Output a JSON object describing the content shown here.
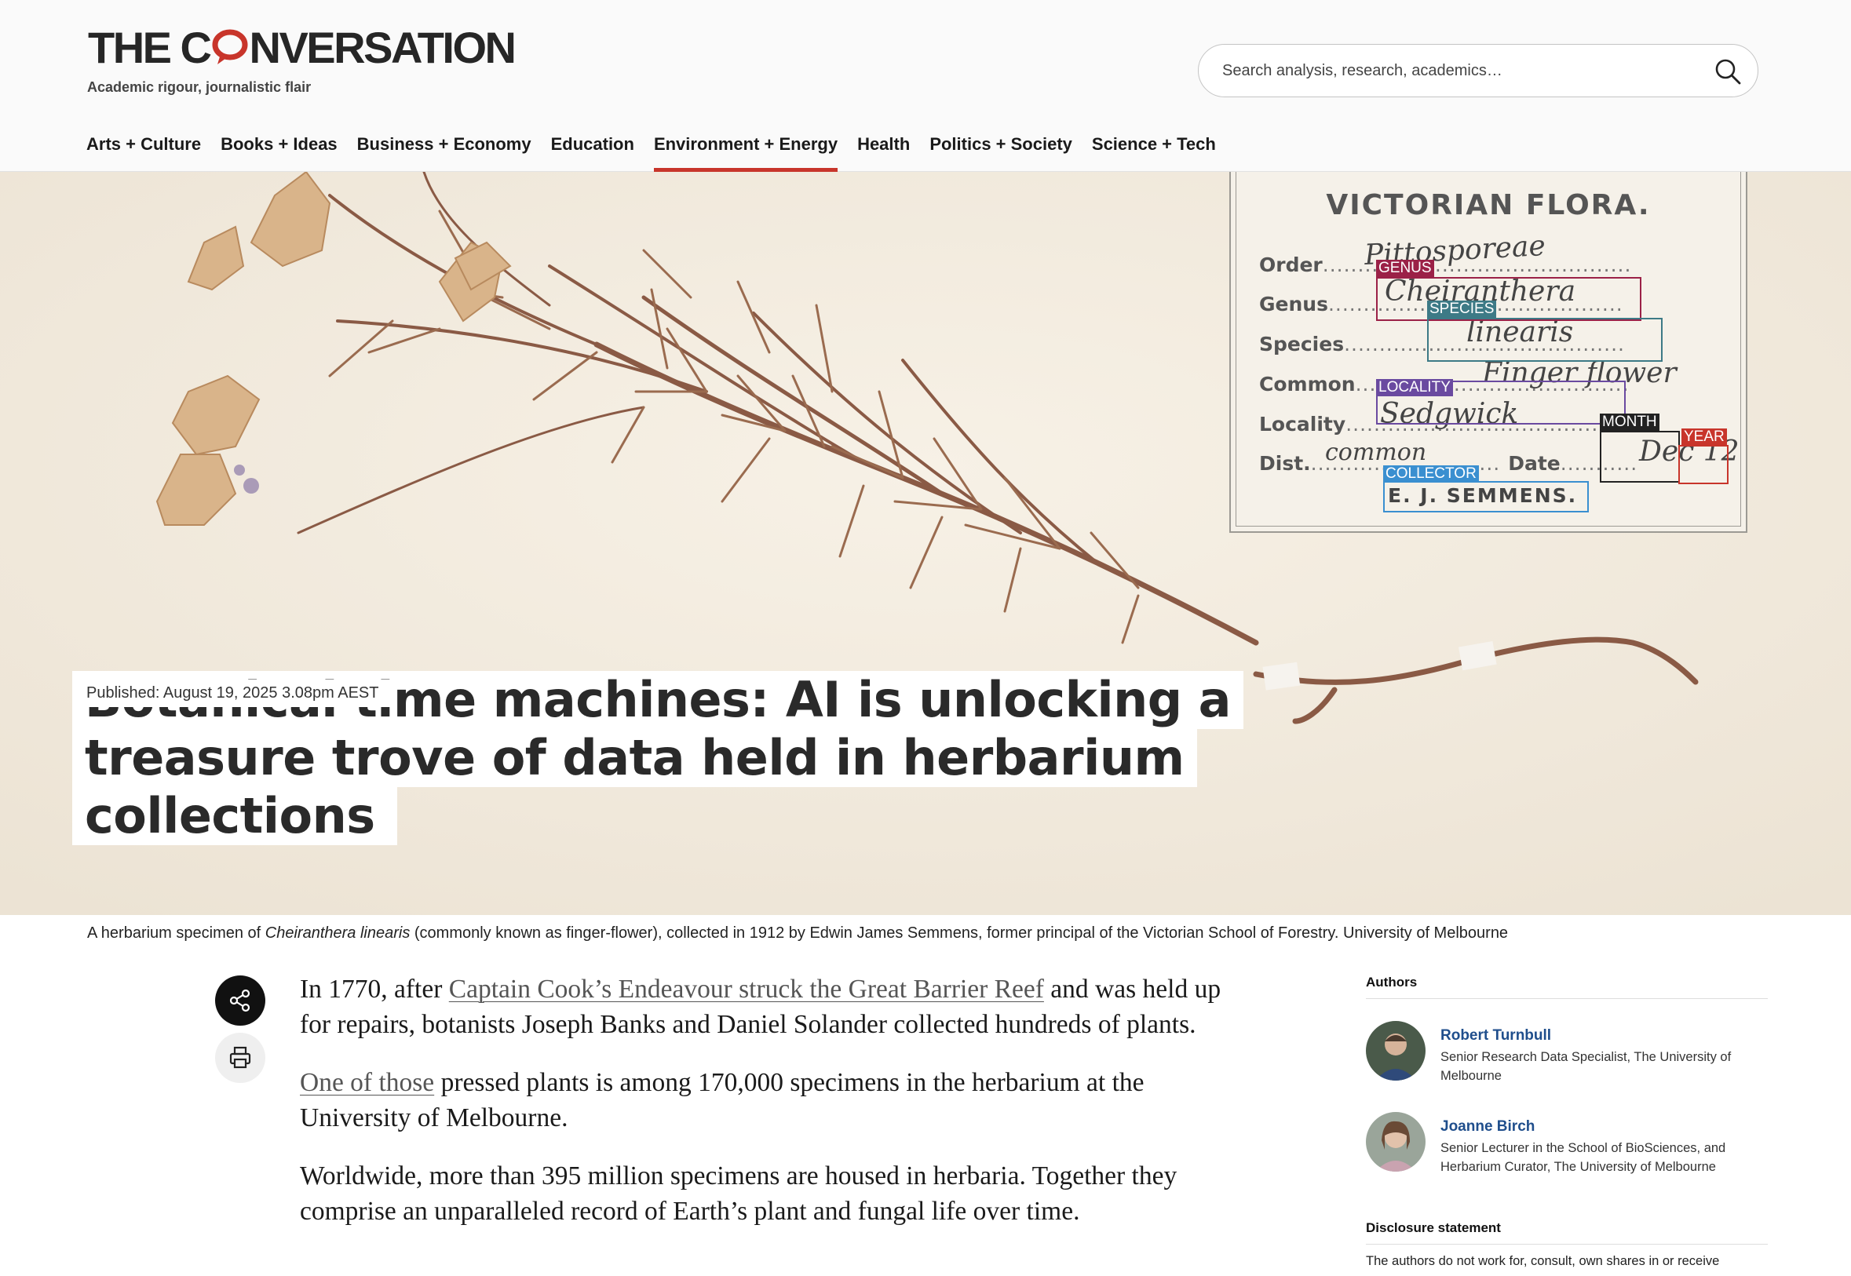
{
  "site": {
    "logo_text_left": "THE C",
    "logo_text_right": "NVERSATION",
    "tagline": "Academic rigour, journalistic flair",
    "brand_color": "#c8352b"
  },
  "search": {
    "placeholder": "Search analysis, research, academics…",
    "icon": "search-icon"
  },
  "nav": {
    "items": [
      {
        "label": "Arts + Culture"
      },
      {
        "label": "Books + Ideas"
      },
      {
        "label": "Business + Economy"
      },
      {
        "label": "Education"
      },
      {
        "label": "Environment + Energy",
        "active": true
      },
      {
        "label": "Health"
      },
      {
        "label": "Politics + Society"
      },
      {
        "label": "Science + Tech"
      }
    ]
  },
  "hero": {
    "label_card": {
      "title": "VICTORIAN FLORA.",
      "fields": {
        "order": "Order",
        "genus": "Genus",
        "species": "Species",
        "common": "Common",
        "locality": "Locality",
        "dist": "Dist.",
        "date": "Date"
      },
      "tags": {
        "genus": "GENUS",
        "species": "SPECIES",
        "locality": "LOCALITY",
        "month": "MONTH",
        "year": "YEAR",
        "collector": "COLLECTOR"
      },
      "collector_name": "E. J. SEMMENS.",
      "tag_colors": {
        "genus": "#9b2147",
        "species": "#3d7a86",
        "locality": "#6a4aa0",
        "month": "#222222",
        "year": "#c8352b",
        "collector": "#3a8fd0"
      }
    },
    "headline_lines": [
      "Botanical time machines: AI is unlocking a",
      "treasure trove of data held in herbarium",
      "collections"
    ],
    "published": "Published: August 19, 2025 3.08pm AEST"
  },
  "caption": {
    "prefix": "A herbarium specimen of ",
    "species_italic": "Cheiranthera linearis",
    "suffix": " (commonly known as finger-flower), collected in 1912 by Edwin James Semmens, former principal of the Victorian School of Forestry. University of Melbourne"
  },
  "article": {
    "p1_before": "In 1770, after ",
    "p1_link": "Captain Cook’s Endeavour struck the Great Barrier Reef",
    "p1_after": " and was held up for repairs, botanists Joseph Banks and Daniel Solander collected hundreds of plants.",
    "p2_link": "One of those",
    "p2_after": " pressed plants is among 170,000 specimens in the herbarium at the University of Melbourne.",
    "p3": "Worldwide, more than 395 million specimens are housed in herbaria. Together they comprise an unparalleled record of Earth’s plant and fungal life over time."
  },
  "actions": {
    "share": "share-icon",
    "print": "print-icon"
  },
  "sidebar": {
    "authors_heading": "Authors",
    "authors": [
      {
        "name": "Robert Turnbull",
        "role": "Senior Research Data Specialist, The University of Melbourne"
      },
      {
        "name": "Joanne Birch",
        "role": "Senior Lecturer in the School of BioSciences, and Herbarium Curator, The University of Melbourne"
      }
    ],
    "disclosure_heading": "Disclosure statement",
    "disclosure_text": "The authors do not work for, consult, own shares in or receive"
  }
}
